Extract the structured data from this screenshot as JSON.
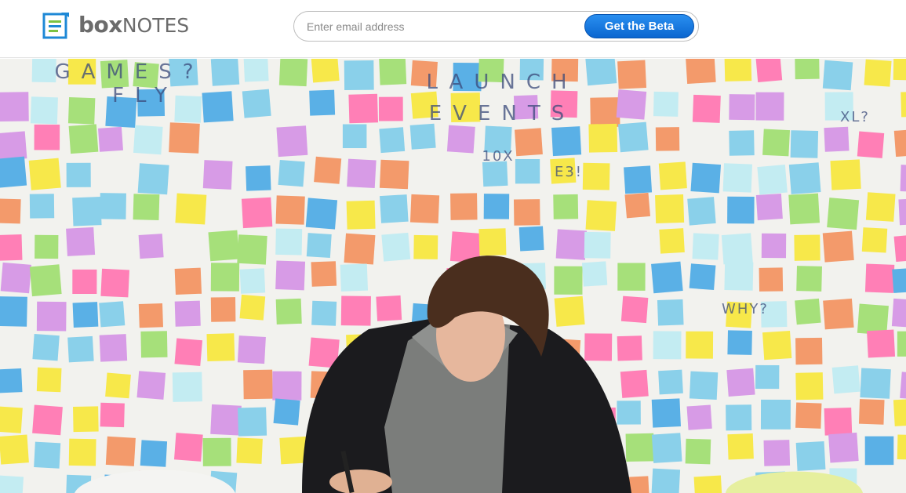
{
  "header": {
    "logo": {
      "part1": "box",
      "part2": "NOTES",
      "icon": "document-list-icon"
    },
    "signup": {
      "email_placeholder": "Enter email address",
      "email_value": "",
      "button_label": "Get the Beta"
    }
  },
  "hero": {
    "wall_words": [
      "GAMES?",
      "FLY",
      "LAUNCH",
      "EVENTS",
      "10X",
      "E3!",
      "WHY?",
      "XL?"
    ]
  },
  "colors": {
    "brand_blue": "#0a66d0",
    "logo_blue": "#1e88d6",
    "logo_green": "#7cc242",
    "text_gray": "#6b6b6b"
  }
}
